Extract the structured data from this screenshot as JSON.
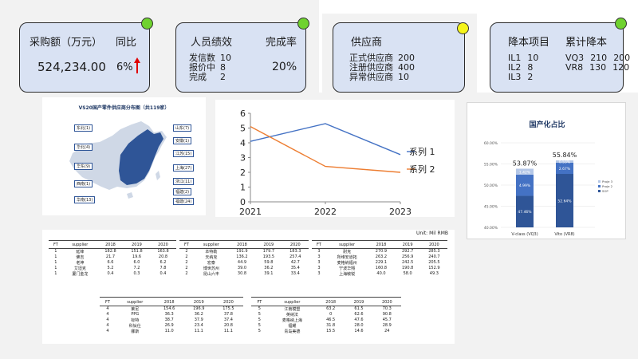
{
  "card_purchase": {
    "label_amount": "采购额（万元）",
    "label_yoy": "同比",
    "amount": "524,234.00",
    "yoy": "6%",
    "status_color": "#6fd22f"
  },
  "card_staff": {
    "label": "人员绩效",
    "label_rate": "完成率",
    "rows": [
      {
        "label": "发信数",
        "value": "10"
      },
      {
        "label": "报价中",
        "value": "8"
      },
      {
        "label": "完成",
        "value": "2"
      }
    ],
    "rate": "20%",
    "status_color": "#6fd22f"
  },
  "card_supplier": {
    "label": "供应商",
    "rows": [
      {
        "label": "正式供应商",
        "value": "200"
      },
      {
        "label": "注册供应商",
        "value": "400"
      },
      {
        "label": "异常供应商",
        "value": "10"
      }
    ],
    "status_color": "#f5f41b"
  },
  "card_cost": {
    "label": "降本项目",
    "label_total": "累计降本",
    "items": [
      {
        "label": "IL1",
        "value": "10"
      },
      {
        "label": "IL2",
        "value": "8"
      },
      {
        "label": "IL3",
        "value": "2"
      }
    ],
    "totals": [
      {
        "label": "VQ3",
        "v1": "210",
        "v2": "200"
      },
      {
        "label": "VR8",
        "v1": "130",
        "v2": "120"
      }
    ],
    "status_color": "#6fd22f"
  },
  "map": {
    "title": "VS20国产零件供应商分布图（共119家）",
    "left_labels": [
      "东北(1)",
      "华北(4)",
      "华东(9)",
      "西南(1)",
      "华南(13)"
    ],
    "right_labels": [
      "山东(7)",
      "安徽(1)",
      "江苏(15)",
      "上海(27)",
      "浙江(11)",
      "福建(2)",
      "福建(24)"
    ]
  },
  "chart_data": [
    {
      "type": "line",
      "categories": [
        "2021",
        "2022",
        "2023"
      ],
      "series": [
        {
          "name": "系列 1",
          "values": [
            4.1,
            5.3,
            3.2
          ],
          "color": "#4472c4"
        },
        {
          "name": "系列 2",
          "values": [
            5.1,
            2.4,
            2.0
          ],
          "color": "#ed7d31"
        }
      ],
      "ylim": [
        0,
        6
      ],
      "yticks": [
        "0",
        "1",
        "2",
        "3",
        "4",
        "5",
        "6"
      ],
      "legend": "right"
    },
    {
      "type": "bar",
      "title": "国产化占比",
      "categories": [
        "V-class (VQ3)",
        "Vito (VR8)"
      ],
      "totals": [
        "53.87%",
        "55.84%"
      ],
      "series": [
        {
          "name": "SOP",
          "values": [
            47.46,
            52.64
          ],
          "labels": [
            "47.46%",
            "52.64%"
          ],
          "color": "#2f5597"
        },
        {
          "name": "Proje 2",
          "values": [
            4.99,
            2.67
          ],
          "labels": [
            "4.99%",
            "2.67%"
          ],
          "color": "#4472c4"
        },
        {
          "name": "Proje 3",
          "values": [
            1.42,
            0.53
          ],
          "labels": [
            "1.42%",
            "0.53%"
          ],
          "color": "#b4c7e7"
        }
      ],
      "yticks": [
        "40.00%",
        "45.00%",
        "50.00%",
        "55.00%",
        "60.00%"
      ],
      "ylim": [
        40,
        60
      ],
      "legend": "right"
    }
  ],
  "table": {
    "unit": "Unit: Mil RMB",
    "headers": [
      "FT",
      "supplier",
      "2018",
      "2019",
      "2020"
    ],
    "groups": [
      {
        "rows": [
          [
            "1",
            "延锋",
            "182.8",
            "151.8",
            "163.8"
          ],
          [
            "1",
            "佛吉",
            "21.7",
            "19.6",
            "20.8"
          ],
          [
            "1",
            "老坤",
            "6.6",
            "6.0",
            "6.2"
          ],
          [
            "1",
            "艾坦克",
            "5.2",
            "7.2",
            "7.8"
          ],
          [
            "1",
            "厦门金龙",
            "0.4",
            "0.3",
            "0.4"
          ]
        ]
      },
      {
        "rows": [
          [
            "2",
            "本特勒",
            "191.9",
            "179.7",
            "183.3"
          ],
          [
            "2",
            "天纳克",
            "136.2",
            "193.5",
            "257.4"
          ],
          [
            "2",
            "宏泰",
            "44.9",
            "59.8",
            "42.7"
          ],
          [
            "2",
            "博世苏州",
            "39.0",
            "36.2",
            "35.4"
          ],
          [
            "2",
            "昆山六丰",
            "30.8",
            "39.1",
            "33.4"
          ]
        ]
      },
      {
        "rows": [
          [
            "3",
            "耐克",
            "270.9",
            "292.7",
            "285.3"
          ],
          [
            "3",
            "所维安道拓",
            "263.2",
            "256.9",
            "240.7"
          ],
          [
            "3",
            "麦格纳福州",
            "229.1",
            "242.5",
            "205.5"
          ],
          [
            "3",
            "宁波华翔",
            "160.8",
            "190.8",
            "152.9"
          ],
          [
            "3",
            "上海敏锐",
            "40.0",
            "58.0",
            "49.3"
          ]
        ]
      },
      {
        "rows": [
          [
            "4",
            "莱尼",
            "154.6",
            "196.9",
            "175.5"
          ],
          [
            "4",
            "PPG",
            "36.3",
            "36.2",
            "37.8"
          ],
          [
            "4",
            "标特",
            "38.7",
            "37.9",
            "37.4"
          ],
          [
            "4",
            "科钛仕",
            "26.9",
            "23.4",
            "20.8"
          ],
          [
            "4",
            "娜斯",
            "11.0",
            "11.1",
            "11.1"
          ]
        ]
      },
      {
        "rows": [
          [
            "5",
            "江南模塑",
            "63.2",
            "61.5",
            "70.3"
          ],
          [
            "5",
            "英纳法",
            "0",
            "62.6",
            "90.8"
          ],
          [
            "5",
            "麦格纳上海",
            "46.5",
            "47.6",
            "45.7"
          ],
          [
            "5",
            "福耀",
            "31.8",
            "28.0",
            "28.9"
          ],
          [
            "5",
            "青岛美德",
            "15.5",
            "14.6",
            "24"
          ]
        ]
      }
    ]
  }
}
